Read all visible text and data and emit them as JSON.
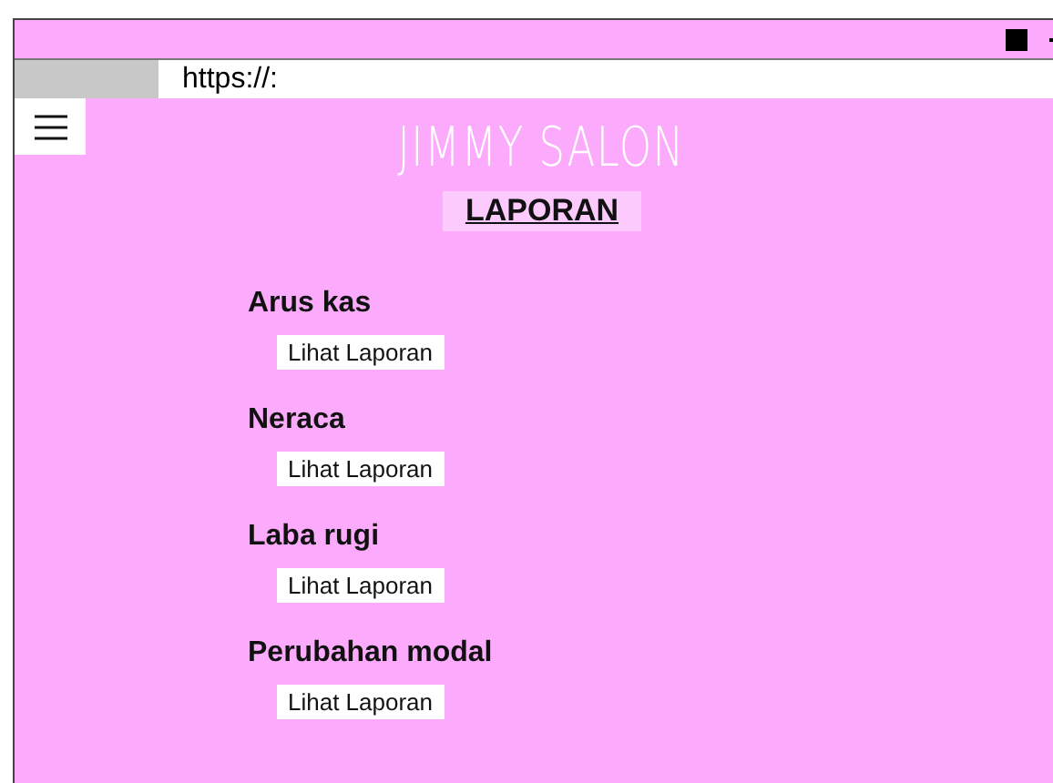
{
  "address_bar": {
    "url": "https://:"
  },
  "header": {
    "title": "JIMMY SALON",
    "heading": "LAPORAN"
  },
  "reports": [
    {
      "name": "Arus kas",
      "button": "Lihat Laporan"
    },
    {
      "name": "Neraca",
      "button": "Lihat Laporan"
    },
    {
      "name": "Laba rugi",
      "button": "Lihat Laporan"
    },
    {
      "name": "Perubahan modal",
      "button": "Lihat Laporan"
    }
  ]
}
